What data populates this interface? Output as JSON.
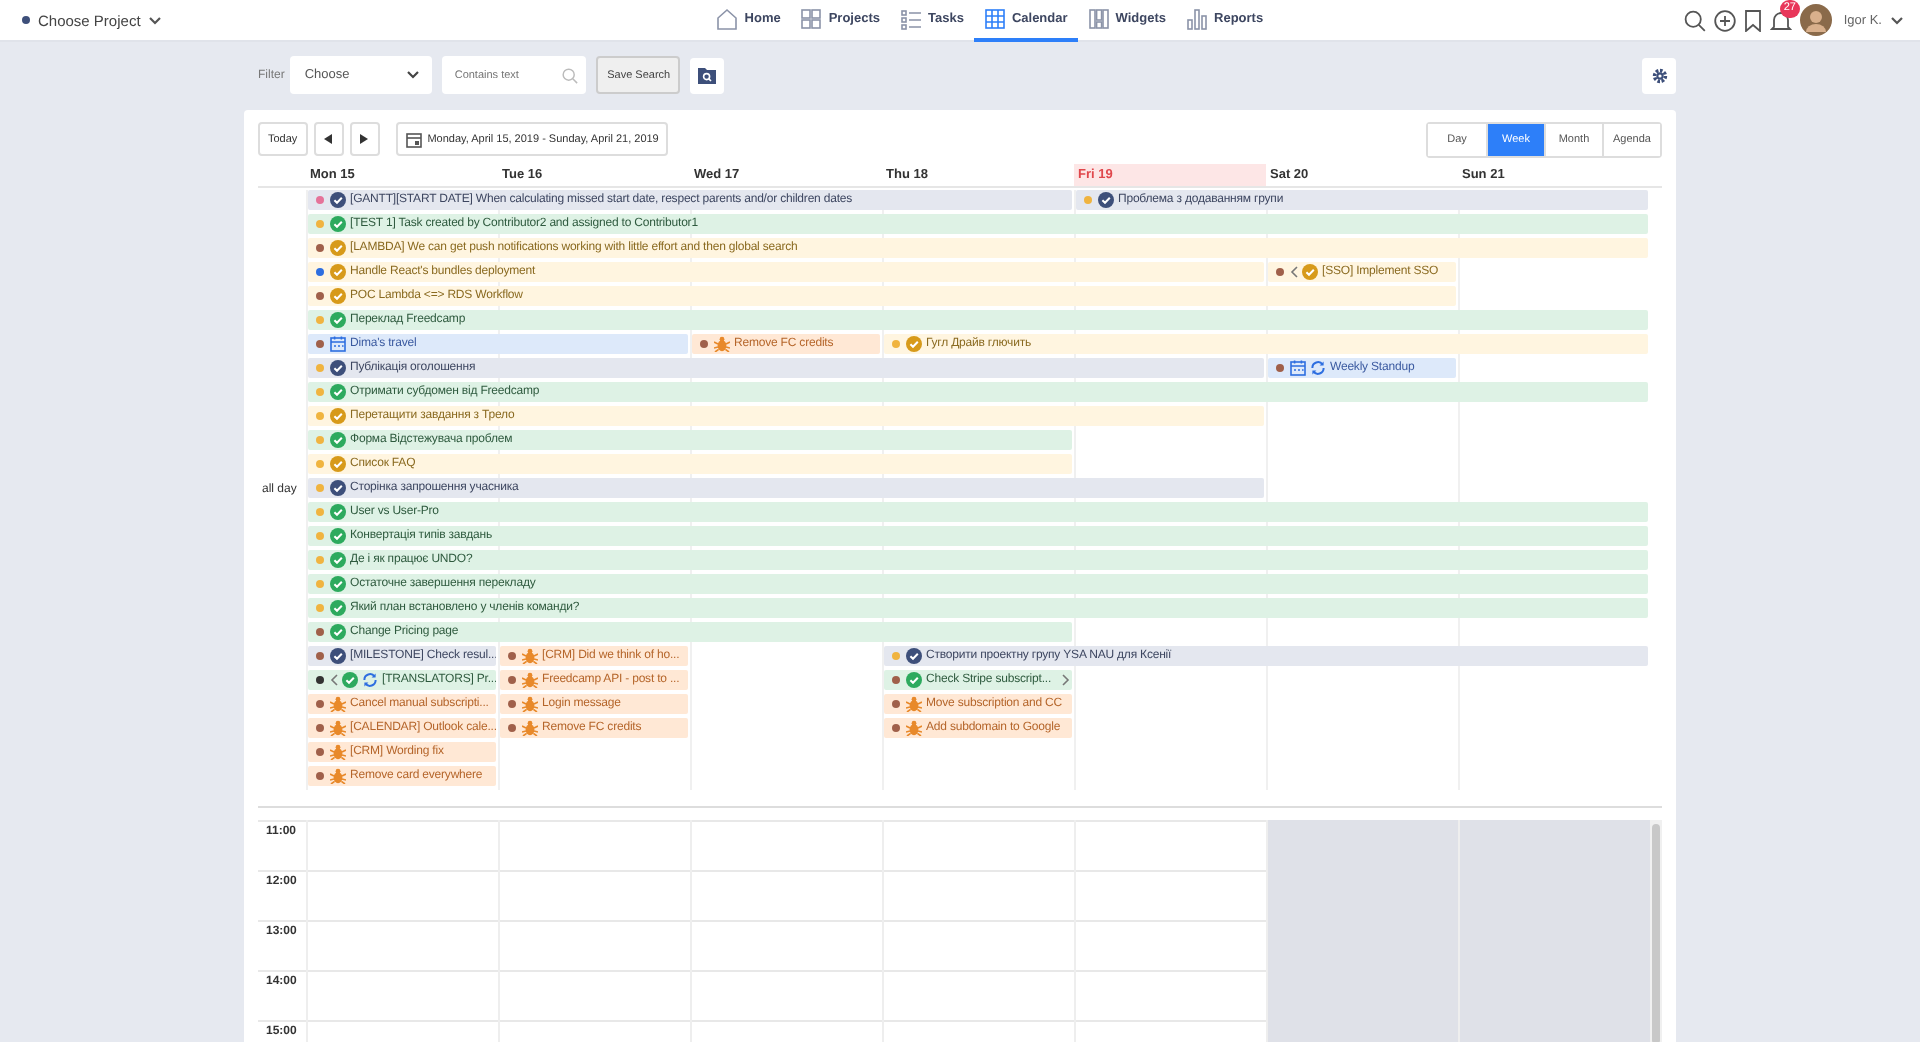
{
  "topbar": {
    "project": "Choose Project",
    "nav": [
      {
        "label": "Home",
        "selected": false
      },
      {
        "label": "Projects",
        "selected": false
      },
      {
        "label": "Tasks",
        "selected": false
      },
      {
        "label": "Calendar",
        "selected": true
      },
      {
        "label": "Widgets",
        "selected": false
      },
      {
        "label": "Reports",
        "selected": false
      }
    ],
    "notifications": "27",
    "user": "Igor K."
  },
  "filter": {
    "label": "Filter",
    "select": "Choose",
    "search": {
      "placeholder": "Contains text"
    },
    "save": "Save Search"
  },
  "toolbar": {
    "today": "Today",
    "range": "Monday, April 15, 2019 - Sunday, April 21, 2019",
    "views": [
      {
        "label": "Day",
        "selected": false
      },
      {
        "label": "Week",
        "selected": true
      },
      {
        "label": "Month",
        "selected": false
      },
      {
        "label": "Agenda",
        "selected": false
      }
    ]
  },
  "days": [
    {
      "label": "Mon 15",
      "today": false,
      "weekend": false
    },
    {
      "label": "Tue 16",
      "today": false,
      "weekend": false
    },
    {
      "label": "Wed 17",
      "today": false,
      "weekend": false
    },
    {
      "label": "Thu 18",
      "today": false,
      "weekend": false
    },
    {
      "label": "Fri 19",
      "today": true,
      "weekend": false
    },
    {
      "label": "Sat 20",
      "today": false,
      "weekend": true
    },
    {
      "label": "Sun 21",
      "today": false,
      "weekend": true
    }
  ],
  "all_day": {
    "label": "all day",
    "lanes": [
      {
        "slots": [
          {
            "kind": "milestone",
            "color": "#e57399",
            "title": "[GANTT][START DATE] When calculating missed start date, respect parents and/or children dates"
          },
          {
            "kind": "more"
          },
          {
            "kind": "more"
          },
          {
            "kind": "more"
          },
          {
            "kind": "milestone",
            "color": "#f0b440",
            "title": "Проблема з додаванням групи"
          },
          {
            "kind": "more"
          },
          {
            "kind": "more"
          }
        ]
      },
      {
        "slots": [
          {
            "kind": "done",
            "color": "#f0b440",
            "title": "[TEST 1] Task created by Contributor2 and assigned to Contributor1"
          },
          {
            "kind": "more"
          },
          {
            "kind": "more"
          },
          {
            "kind": "more"
          },
          {
            "kind": "more"
          },
          {
            "kind": "more"
          },
          {
            "kind": "more"
          }
        ]
      },
      {
        "slots": [
          {
            "kind": "task",
            "color": "#a0604a",
            "title": "[LAMBDA] We can get push notifications working with little effort and then global search"
          },
          {
            "kind": "more"
          },
          {
            "kind": "more"
          },
          {
            "kind": "more"
          },
          {
            "kind": "more"
          },
          {
            "kind": "more"
          },
          {
            "kind": "more"
          }
        ]
      },
      {
        "slots": [
          {
            "kind": "task",
            "color": "#2d6ee0",
            "title": "Handle React's bundles deployment"
          },
          {
            "kind": "more"
          },
          {
            "kind": "more"
          },
          {
            "kind": "more"
          },
          {
            "kind": "more"
          },
          {
            "kind": "task",
            "color": "#a0604a",
            "title": "[SSO] Implement SSO",
            "continues_before": true
          },
          {
            "kind": "empty"
          }
        ]
      },
      {
        "slots": [
          {
            "kind": "task",
            "color": "#a0604a",
            "title": "POC Lambda <=> RDS Workflow"
          },
          {
            "kind": "more"
          },
          {
            "kind": "more"
          },
          {
            "kind": "more"
          },
          {
            "kind": "more"
          },
          {
            "kind": "more"
          },
          {
            "kind": "empty"
          }
        ]
      },
      {
        "slots": [
          {
            "kind": "done",
            "color": "#f0b440",
            "title": "Переклад Freedcamp"
          },
          {
            "kind": "more"
          },
          {
            "kind": "more"
          },
          {
            "kind": "more"
          },
          {
            "kind": "more"
          },
          {
            "kind": "more"
          },
          {
            "kind": "more"
          }
        ]
      },
      {
        "slots": [
          {
            "kind": "event",
            "color": "#a0604a",
            "title": "Dima's travel"
          },
          {
            "kind": "more"
          },
          {
            "kind": "issue",
            "color": "#a0604a",
            "title": "Remove FC credits"
          },
          {
            "kind": "task",
            "color": "#f0b440",
            "title": "Гугл Драйв глючить"
          },
          {
            "kind": "more"
          },
          {
            "kind": "more"
          },
          {
            "kind": "more"
          }
        ]
      },
      {
        "slots": [
          {
            "kind": "milestone",
            "color": "#f0b440",
            "title": "Публікація оголошення"
          },
          {
            "kind": "more"
          },
          {
            "kind": "more"
          },
          {
            "kind": "more"
          },
          {
            "kind": "more"
          },
          {
            "kind": "event",
            "color": "#a0604a",
            "title": "Weekly Standup",
            "recurring": true
          },
          {
            "kind": "empty"
          }
        ]
      },
      {
        "slots": [
          {
            "kind": "done",
            "color": "#f0b440",
            "title": "Отримати субдомен від Freedcamp"
          },
          {
            "kind": "more"
          },
          {
            "kind": "more"
          },
          {
            "kind": "more"
          },
          {
            "kind": "more"
          },
          {
            "kind": "more"
          },
          {
            "kind": "more"
          }
        ]
      },
      {
        "slots": [
          {
            "kind": "task",
            "color": "#f0b440",
            "title": "Перетащити завдання з Трело"
          },
          {
            "kind": "more"
          },
          {
            "kind": "more"
          },
          {
            "kind": "more"
          },
          {
            "kind": "more"
          },
          {
            "kind": "empty"
          },
          {
            "kind": "empty"
          }
        ]
      },
      {
        "slots": [
          {
            "kind": "done",
            "color": "#f0b440",
            "title": "Форма Відстежувача проблем"
          },
          {
            "kind": "more"
          },
          {
            "kind": "more"
          },
          {
            "kind": "more"
          },
          {
            "kind": "empty"
          },
          {
            "kind": "empty"
          },
          {
            "kind": "empty"
          }
        ]
      },
      {
        "slots": [
          {
            "kind": "task",
            "color": "#f0b440",
            "title": "Список FAQ"
          },
          {
            "kind": "more"
          },
          {
            "kind": "more"
          },
          {
            "kind": "more"
          },
          {
            "kind": "empty"
          },
          {
            "kind": "empty"
          },
          {
            "kind": "empty"
          }
        ]
      },
      {
        "slots": [
          {
            "kind": "milestone",
            "color": "#f0b440",
            "title": "Сторінка запрошення учасника"
          },
          {
            "kind": "more"
          },
          {
            "kind": "more"
          },
          {
            "kind": "more"
          },
          {
            "kind": "more"
          },
          {
            "kind": "empty"
          },
          {
            "kind": "empty"
          }
        ]
      },
      {
        "slots": [
          {
            "kind": "done",
            "color": "#f0b440",
            "title": "User vs User-Pro"
          },
          {
            "kind": "more"
          },
          {
            "kind": "more"
          },
          {
            "kind": "more"
          },
          {
            "kind": "more"
          },
          {
            "kind": "more"
          },
          {
            "kind": "more"
          }
        ]
      },
      {
        "slots": [
          {
            "kind": "done",
            "color": "#f0b440",
            "title": "Конвертація типів завдань"
          },
          {
            "kind": "more"
          },
          {
            "kind": "more"
          },
          {
            "kind": "more"
          },
          {
            "kind": "more"
          },
          {
            "kind": "more"
          },
          {
            "kind": "more"
          }
        ]
      },
      {
        "slots": [
          {
            "kind": "done",
            "color": "#f0b440",
            "title": "Де і як працює UNDO?"
          },
          {
            "kind": "more"
          },
          {
            "kind": "more"
          },
          {
            "kind": "more"
          },
          {
            "kind": "more"
          },
          {
            "kind": "more"
          },
          {
            "kind": "more"
          }
        ]
      },
      {
        "slots": [
          {
            "kind": "done",
            "color": "#f0b440",
            "title": "Остаточне завершення перекладу"
          },
          {
            "kind": "more"
          },
          {
            "kind": "more"
          },
          {
            "kind": "more"
          },
          {
            "kind": "more"
          },
          {
            "kind": "more"
          },
          {
            "kind": "more"
          }
        ]
      },
      {
        "slots": [
          {
            "kind": "done",
            "color": "#f0b440",
            "title": "Який план встановлено у членів команди?"
          },
          {
            "kind": "more"
          },
          {
            "kind": "more"
          },
          {
            "kind": "more"
          },
          {
            "kind": "more"
          },
          {
            "kind": "more"
          },
          {
            "kind": "more"
          }
        ]
      },
      {
        "slots": [
          {
            "kind": "done",
            "color": "#a0604a",
            "title": "Change Pricing page"
          },
          {
            "kind": "more"
          },
          {
            "kind": "more"
          },
          {
            "kind": "more"
          },
          {
            "kind": "empty"
          },
          {
            "kind": "empty"
          },
          {
            "kind": "empty"
          }
        ]
      },
      {
        "slots": [
          {
            "kind": "milestone",
            "color": "#a0604a",
            "title": "[MILESTONE] Check resul..."
          },
          {
            "kind": "issue",
            "color": "#a0604a",
            "title": "[CRM] Did we think of ho..."
          },
          {
            "kind": "empty"
          },
          {
            "kind": "milestone",
            "color": "#f0b440",
            "title": "Створити проектну групу YSA NAU для Ксенії"
          },
          {
            "kind": "more"
          },
          {
            "kind": "more"
          },
          {
            "kind": "more"
          }
        ]
      },
      {
        "slots": [
          {
            "kind": "done",
            "color": "#333333",
            "title": "[TRANSLATORS] Pr...",
            "continues_before": true,
            "recurring": true
          },
          {
            "kind": "issue",
            "color": "#a0604a",
            "title": "Freedcamp API - post to ..."
          },
          {
            "kind": "empty"
          },
          {
            "kind": "done",
            "color": "#a0604a",
            "title": "Check Stripe subscript...",
            "continues_after": true
          },
          {
            "kind": "empty"
          },
          {
            "kind": "empty"
          },
          {
            "kind": "empty"
          }
        ]
      },
      {
        "slots": [
          {
            "kind": "issue",
            "color": "#a0604a",
            "title": "Cancel manual subscripti..."
          },
          {
            "kind": "issue",
            "color": "#a0604a",
            "title": "Login message"
          },
          {
            "kind": "empty"
          },
          {
            "kind": "issue",
            "color": "#a0604a",
            "title": "Move subscription and CC"
          },
          {
            "kind": "empty"
          },
          {
            "kind": "empty"
          },
          {
            "kind": "empty"
          }
        ]
      },
      {
        "slots": [
          {
            "kind": "issue",
            "color": "#a0604a",
            "title": "[CALENDAR] Outlook cale..."
          },
          {
            "kind": "issue",
            "color": "#a0604a",
            "title": "Remove FC credits"
          },
          {
            "kind": "empty"
          },
          {
            "kind": "issue",
            "color": "#a0604a",
            "title": "Add subdomain to Google"
          },
          {
            "kind": "empty"
          },
          {
            "kind": "empty"
          },
          {
            "kind": "empty"
          }
        ]
      },
      {
        "slots": [
          {
            "kind": "issue",
            "color": "#a0604a",
            "title": "[CRM] Wording fix"
          },
          {
            "kind": "empty"
          },
          {
            "kind": "empty"
          },
          {
            "kind": "empty"
          },
          {
            "kind": "empty"
          },
          {
            "kind": "empty"
          },
          {
            "kind": "empty"
          }
        ]
      },
      {
        "slots": [
          {
            "kind": "issue",
            "color": "#a0604a",
            "title": "Remove card everywhere"
          },
          {
            "kind": "empty"
          },
          {
            "kind": "empty"
          },
          {
            "kind": "empty"
          },
          {
            "kind": "empty"
          },
          {
            "kind": "empty"
          },
          {
            "kind": "empty"
          }
        ]
      }
    ]
  },
  "times": [
    "11:00",
    "12:00",
    "13:00",
    "14:00",
    "15:00"
  ]
}
